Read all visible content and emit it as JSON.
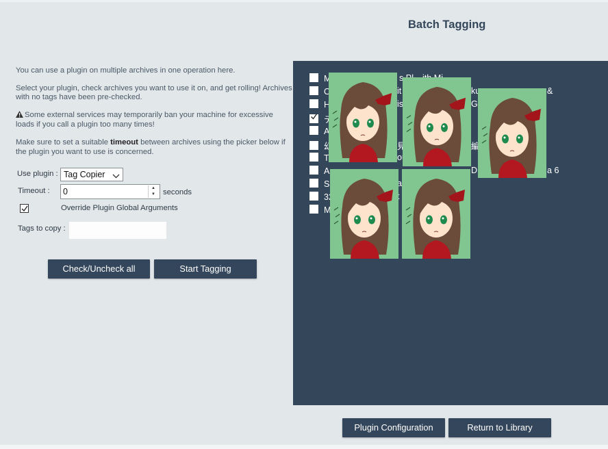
{
  "page": {
    "title": "Batch Tagging"
  },
  "intro": {
    "line1": "You can use a plugin on multiple archives in one operation here.",
    "line2": "Select your plugin, check archives you want to use it on, and get rolling! Archives with no tags have been pre-checked.",
    "warning": "Some external services may temporarily ban your machine for excessive loads if you call a plugin too many times!",
    "timeout_pre": "Make sure to set a suitable ",
    "timeout_bold": "timeout",
    "timeout_post": " between archives using the picker below if the plugin you want to use is concerned."
  },
  "form": {
    "plugin_label": "Use plugin :",
    "plugin_selected": "Tag Copier",
    "timeout_label": "Timeout :",
    "timeout_value": "0",
    "timeout_unit": "seconds",
    "override_label": "Override Plugin Global Arguments",
    "override_checked": true,
    "tags_label": "Tags to copy :",
    "tags_value": ""
  },
  "buttons": {
    "check_all": "Check/Uncheck all",
    "start": "Start Tagging",
    "plugin_config": "Plugin Configuration",
    "return": "Return to Library"
  },
  "archives": [
    {
      "label": "M",
      "checked": false
    },
    {
      "label": "O",
      "checked": false
    },
    {
      "label": "H",
      "checked": false
    },
    {
      "label": "テ",
      "checked": true
    },
    {
      "label": "A",
      "checked": false
    },
    {
      "label": "幻",
      "checked": false
    },
    {
      "label": "T",
      "checked": false
    },
    {
      "label": "A",
      "checked": false
    },
    {
      "label": "Sa",
      "checked": false
    },
    {
      "label": "32",
      "checked": false
    },
    {
      "label": "M",
      "checked": false
    }
  ],
  "archive_fragments": [
    "s Pl",
    "ith Mi",
    "it",
    "ku",
    "&",
    "is",
    "Gia",
    "見",
    "編",
    "ou",
    "D",
    "a 6",
    "a",
    "t"
  ],
  "colors": {
    "panel": "#33465a",
    "button": "#34465b",
    "thumb_bg": "#81c591"
  }
}
